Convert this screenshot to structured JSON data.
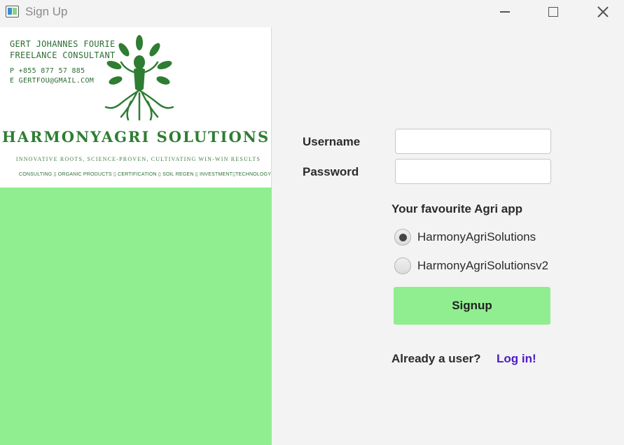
{
  "window": {
    "title": "Sign Up",
    "controls": [
      "minimize-icon",
      "maximize-icon",
      "close-icon"
    ]
  },
  "banner": {
    "contact_name": "GERT JOHANNES FOURIE",
    "contact_role": "FREELANCE CONSULTANT",
    "phone": "P   +855 877 57 885",
    "email": "E   GERTFOU@GMAIL.COM",
    "company": "HARMONYAGRI SOLUTIONS",
    "tagline": "INNOVATIVE ROOTS, SCIENCE-PROVEN, CULTIVATING WIN-WIN RESULTS",
    "services": "CONSULTING ▯ ORGANIC PRODUCTS ▯ CERTIFICATION ▯ SOIL REGEN ▯ INVESTMENT▯TECHNOLOGY",
    "logo_icon": "tree-of-life-logo",
    "colors": {
      "brand_green": "#2e7d32",
      "panel_green": "#90ee90"
    }
  },
  "form": {
    "username_label": "Username",
    "password_label": "Password",
    "username_value": "",
    "password_value": "",
    "radio_heading": "Your favourite Agri app",
    "options": [
      {
        "label": "HarmonyAgriSolutions",
        "selected": true
      },
      {
        "label": "HarmonyAgriSolutionsv2",
        "selected": false
      }
    ],
    "signup_label": "Signup",
    "already_user_text": "Already a user?",
    "login_link": "Log in!",
    "colors": {
      "button": "#90ee90",
      "link": "#4b19c8"
    }
  }
}
